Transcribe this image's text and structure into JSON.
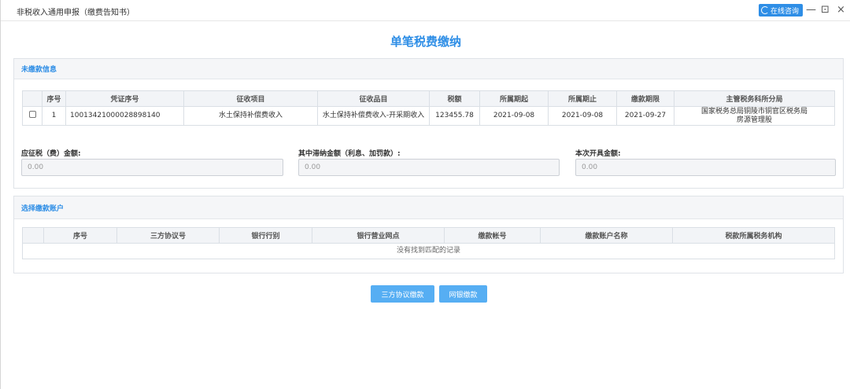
{
  "window": {
    "title": "非税收入通用申报（缴费告知书）",
    "consult_label": "在线咨询",
    "minimize": "—",
    "restore": "⊡",
    "close": "×"
  },
  "page_title": "单笔税费缴纳",
  "unpaid": {
    "section_title": "未缴款信息",
    "columns": [
      "序号",
      "凭证序号",
      "征收项目",
      "征收品目",
      "税额",
      "所属期起",
      "所属期止",
      "缴款期限",
      "主管税务科所分局"
    ],
    "rows": [
      [
        "1",
        "10013421000028898140",
        "水土保持补偿费收入",
        "水土保持补偿费收入-开采期收入",
        "123455.78",
        "2021-09-08",
        "2021-09-08",
        "2021-09-27",
        "国家税务总局铜陵市铜官区税务局房源管理股"
      ]
    ]
  },
  "fields": {
    "levy_label": "应征税（费）金额:",
    "levy_value": "0.00",
    "late_label": "其中滞纳金额（利息、加罚款）:",
    "late_value": "0.00",
    "invoice_label": "本次开具金额:",
    "invoice_value": "0.00"
  },
  "account": {
    "section_title": "选择缴款账户",
    "columns": [
      "序号",
      "三方协议号",
      "银行行别",
      "银行营业网点",
      "缴款帐号",
      "缴款账户名称",
      "税款所属税务机构"
    ],
    "empty_text": "没有找到匹配的记录"
  },
  "buttons": {
    "tripartite": "三方协议缴款",
    "online_bank": "网银缴款"
  },
  "colors": {
    "accent": "#2e8ee6",
    "button": "#56aef3"
  }
}
